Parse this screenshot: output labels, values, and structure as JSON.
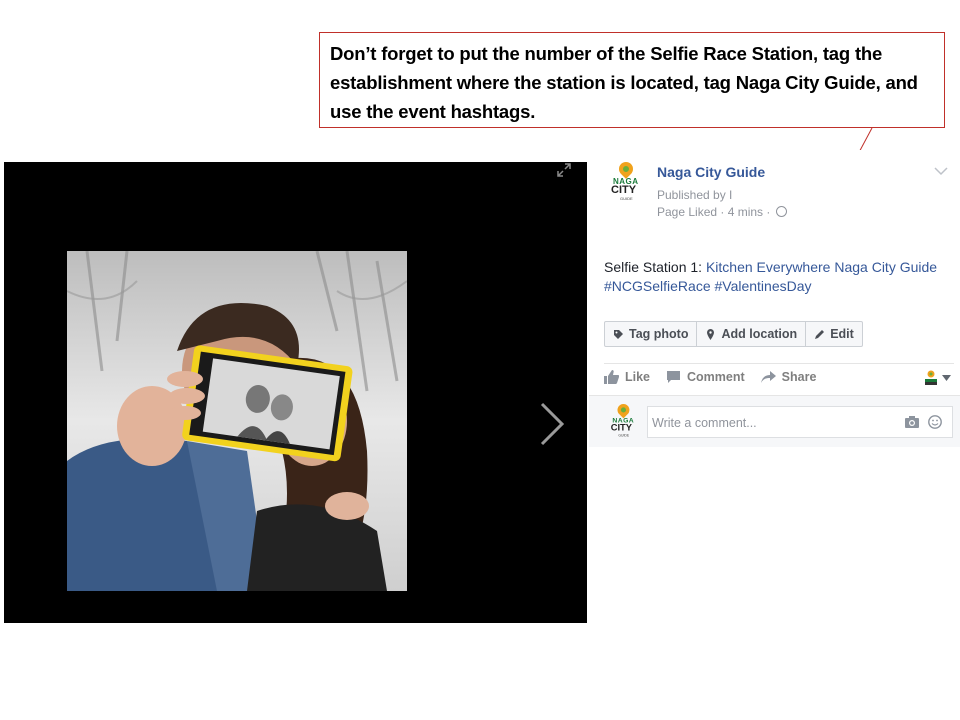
{
  "annotation": {
    "text": "Don’t forget to put the number of the Selfie Race Station, tag the establishment where the station is located, tag Naga City Guide, and use the event hashtags."
  },
  "post": {
    "page_name": "Naga City Guide",
    "published_by": "Published by I",
    "liked_time": "Page Liked · 4 mins ·",
    "text_prefix": "Selfie Station 1: ",
    "text_link": "Kitchen Everywhere Naga City Guide",
    "hashtags": "#NCGSelfieRace #ValentinesDay"
  },
  "logo": {
    "line1": "NAGA",
    "line2": "CITY",
    "line3": "GUIDE"
  },
  "buttons": {
    "tag_photo": "Tag photo",
    "add_location": "Add location",
    "edit": "Edit"
  },
  "actions": {
    "like": "Like",
    "comment": "Comment",
    "share": "Share"
  },
  "comment": {
    "placeholder": "Write a comment..."
  },
  "icons": [
    "expand-icon",
    "chevron-right-icon",
    "chevron-down-icon",
    "globe-icon",
    "tag-icon",
    "location-pin-icon",
    "pencil-icon",
    "like-icon",
    "comment-icon",
    "share-icon",
    "camera-icon",
    "smiley-icon"
  ],
  "colors": {
    "link": "#365899",
    "callout_border": "#c0302a",
    "meta": "#90949c"
  }
}
